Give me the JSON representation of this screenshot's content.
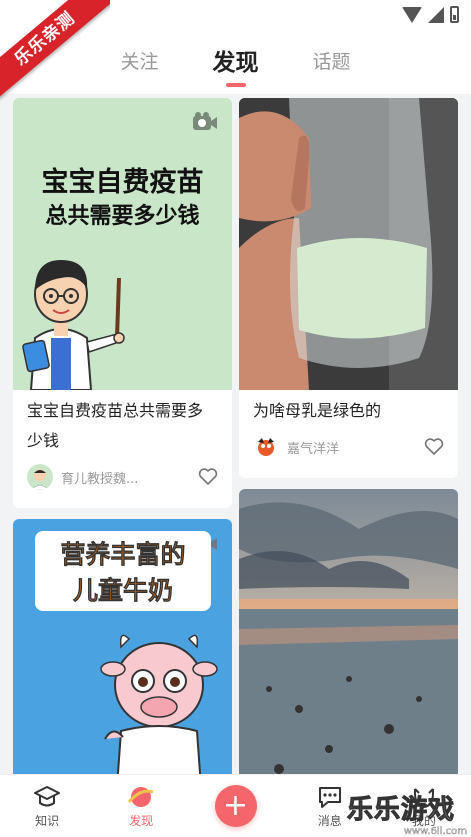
{
  "watermark": {
    "text": "乐乐亲测"
  },
  "tabs": [
    {
      "label": "关注",
      "active": false
    },
    {
      "label": "发现",
      "active": true
    },
    {
      "label": "话题",
      "active": false
    }
  ],
  "cards": [
    {
      "column": "left",
      "poster_line1": "宝宝自费疫苗",
      "poster_line2": "总共需要多少钱",
      "title_line1": "宝宝自费疫苗总共需要多",
      "title_line2": "少钱",
      "author": "育儿教授魏...",
      "has_video": true
    },
    {
      "column": "right",
      "title_line1": "为啥母乳是绿色的",
      "author": "嘉气洋洋",
      "has_video": false
    },
    {
      "column": "left",
      "poster_line1": "营养丰富的",
      "poster_line2": "儿童牛奶",
      "has_video": true
    },
    {
      "column": "right",
      "has_video": false
    }
  ],
  "bottom_nav": [
    {
      "label": "知识",
      "icon": "graduation-cap-icon",
      "active": false
    },
    {
      "label": "发现",
      "icon": "discover-planet-icon",
      "active": true
    },
    {
      "label": "",
      "icon": "plus-icon",
      "active": false
    },
    {
      "label": "消息",
      "icon": "chat-bubble-icon",
      "active": false
    },
    {
      "label": "我的",
      "icon": "profile-icon",
      "active": false
    }
  ],
  "corner_logo": {
    "text": "乐乐游戏",
    "url": "www.6ll.com"
  },
  "colors": {
    "accent": "#f4666b",
    "poster_bg": "#c9e6c9",
    "poster_blue": "#4aa3e0"
  }
}
